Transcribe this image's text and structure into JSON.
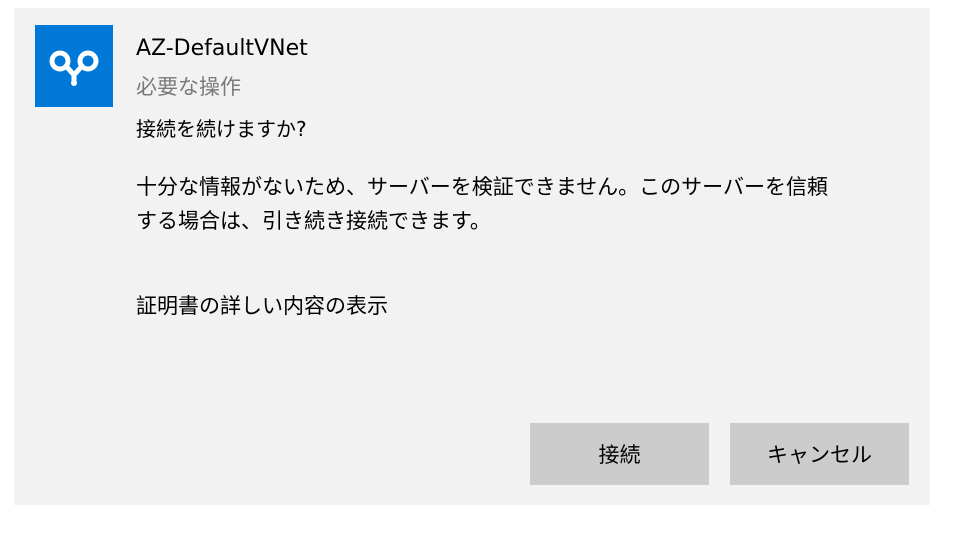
{
  "dialog": {
    "app_icon": "vpn-network-icon",
    "app_name": "AZ-DefaultVNet",
    "subtitle": "必要な操作",
    "question": "接続を続けますか?",
    "message_line1": "十分な情報がないため、サーバーを検証できません。このサーバーを信頼",
    "message_line2": "する場合は、引き続き接続できます。",
    "cert_link": "証明書の詳しい内容の表示",
    "connect_label": "接続",
    "cancel_label": "キャンセル"
  },
  "colors": {
    "icon_background": "#0078d7",
    "dialog_background": "#f2f2f2",
    "button_background": "#cccccc",
    "subtitle_text": "#7a7a7a"
  }
}
